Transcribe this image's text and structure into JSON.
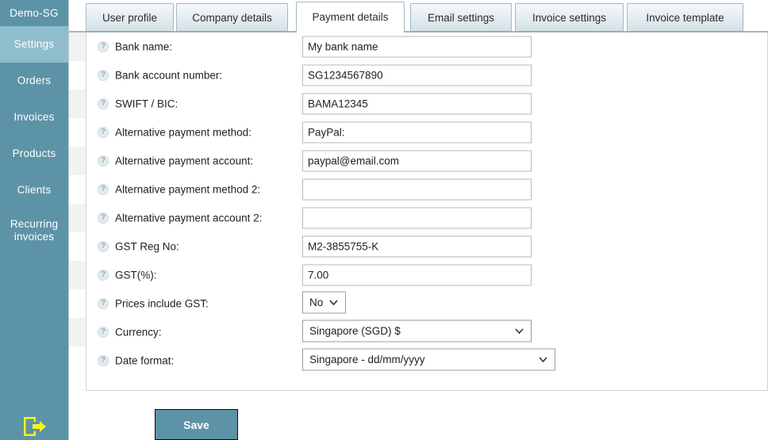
{
  "sidebar": {
    "brand": "Demo-SG",
    "items": [
      {
        "label": "Settings",
        "active": true
      },
      {
        "label": "Orders",
        "active": false
      },
      {
        "label": "Invoices",
        "active": false
      },
      {
        "label": "Products",
        "active": false
      },
      {
        "label": "Clients",
        "active": false
      },
      {
        "label": "Recurring invoices",
        "active": false
      }
    ],
    "logout_icon": "logout-icon",
    "background_color": "#5d93a6",
    "active_color": "#8fbdcd"
  },
  "tabs": [
    {
      "label": "User profile",
      "active": false
    },
    {
      "label": "Company details",
      "active": false
    },
    {
      "label": "Payment details",
      "active": true
    },
    {
      "label": "Email settings",
      "active": false
    },
    {
      "label": "Invoice settings",
      "active": false
    },
    {
      "label": "Invoice template",
      "active": false
    }
  ],
  "form": {
    "help_icon": "help-circle-icon",
    "rows": [
      {
        "label": "Bank name:",
        "type": "text",
        "value": "My bank name",
        "placeholder": ""
      },
      {
        "label": "Bank account number:",
        "type": "text",
        "value": "SG1234567890",
        "placeholder": ""
      },
      {
        "label": "SWIFT / BIC:",
        "type": "text",
        "value": "BAMA12345",
        "placeholder": ""
      },
      {
        "label": "Alternative payment method:",
        "type": "text",
        "value": "PayPal:",
        "placeholder": ""
      },
      {
        "label": "Alternative payment account:",
        "type": "text",
        "value": "paypal@email.com",
        "placeholder": ""
      },
      {
        "label": "Alternative payment method 2:",
        "type": "text",
        "value": "",
        "placeholder": ""
      },
      {
        "label": "Alternative payment account 2:",
        "type": "text",
        "value": "",
        "placeholder": ""
      },
      {
        "label": "GST Reg No:",
        "type": "text",
        "value": "M2-3855755-K",
        "placeholder": ""
      },
      {
        "label": "GST(%):",
        "type": "text",
        "value": "7.00",
        "placeholder": ""
      },
      {
        "label": "Prices include GST:",
        "type": "select",
        "value": "No",
        "size": "small"
      },
      {
        "label": "Currency:",
        "type": "select",
        "value": "Singapore (SGD) $",
        "size": "medium"
      },
      {
        "label": "Date format:",
        "type": "select",
        "value": "Singapore - dd/mm/yyyy",
        "size": "large"
      }
    ]
  },
  "actions": {
    "save_label": "Save"
  }
}
